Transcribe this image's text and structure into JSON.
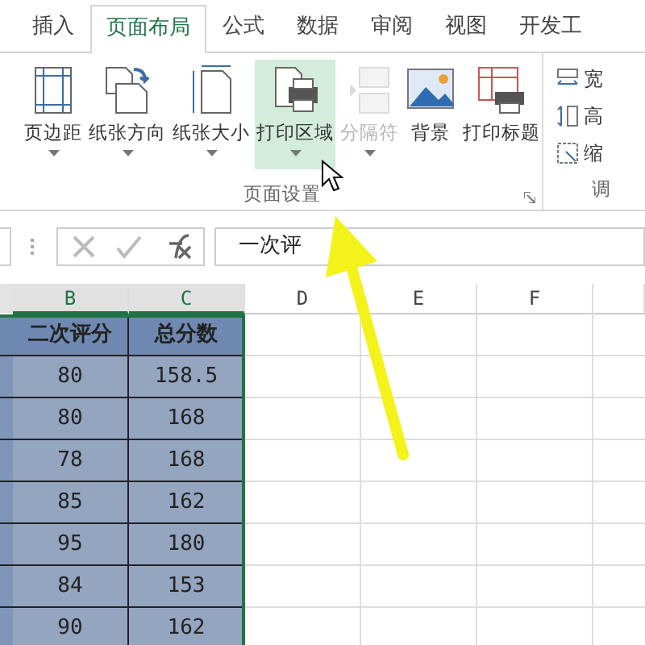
{
  "tabs": [
    {
      "label": "插入",
      "selected": false
    },
    {
      "label": "页面布局",
      "selected": true
    },
    {
      "label": "公式",
      "selected": false
    },
    {
      "label": "数据",
      "selected": false
    },
    {
      "label": "审阅",
      "selected": false
    },
    {
      "label": "视图",
      "selected": false
    },
    {
      "label": "开发工",
      "selected": false
    }
  ],
  "ribbon": {
    "group_label": "页面设置",
    "buttons": [
      {
        "label": "页边距",
        "kind": "margins",
        "dropdown": true,
        "selected": false,
        "disabled": false
      },
      {
        "label": "纸张方向",
        "kind": "orientation",
        "dropdown": true,
        "selected": false,
        "disabled": false
      },
      {
        "label": "纸张大小",
        "kind": "size",
        "dropdown": true,
        "selected": false,
        "disabled": false
      },
      {
        "label": "打印区域",
        "kind": "print-area",
        "dropdown": true,
        "selected": true,
        "disabled": false
      },
      {
        "label": "分隔符",
        "kind": "breaks",
        "dropdown": true,
        "selected": false,
        "disabled": true
      },
      {
        "label": "背景",
        "kind": "background",
        "dropdown": false,
        "selected": false,
        "disabled": false
      },
      {
        "label": "打印标题",
        "kind": "print-titles",
        "dropdown": false,
        "selected": false,
        "disabled": false
      }
    ],
    "side_group": {
      "items": [
        {
          "label": "宽",
          "kind": "width"
        },
        {
          "label": "高",
          "kind": "height"
        },
        {
          "label": "缩",
          "kind": "scale"
        }
      ],
      "group_label": "调"
    }
  },
  "formula_bar": {
    "value": "一次评"
  },
  "sheet": {
    "columns": [
      "B",
      "C",
      "D",
      "E",
      "F"
    ],
    "header": [
      "二次评分",
      "总分数"
    ],
    "rows": [
      [
        "80",
        "158.5"
      ],
      [
        "80",
        "168"
      ],
      [
        "78",
        "168"
      ],
      [
        "85",
        "162"
      ],
      [
        "95",
        "180"
      ],
      [
        "84",
        "153"
      ],
      [
        "90",
        "162"
      ]
    ]
  }
}
